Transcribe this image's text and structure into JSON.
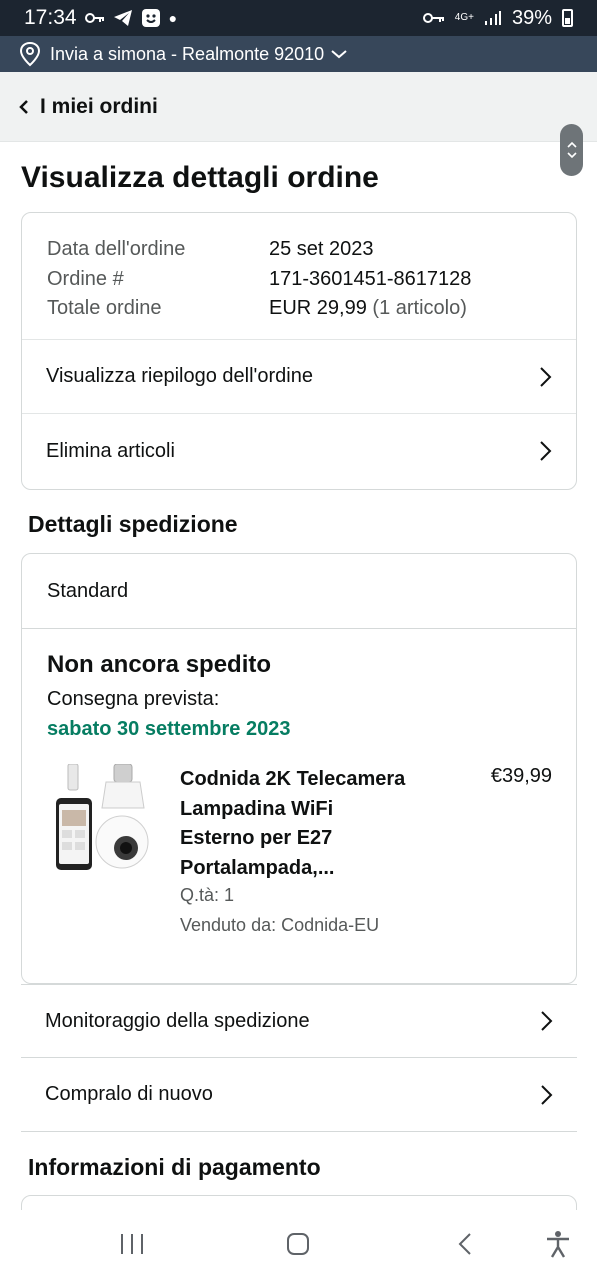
{
  "status_bar": {
    "time": "17:34",
    "network": "4G+",
    "battery": "39%"
  },
  "deliver_bar": {
    "text": "Invia a simona - Realmonte 92010"
  },
  "header": {
    "back_label": "I miei ordini"
  },
  "page": {
    "title": "Visualizza dettagli ordine"
  },
  "order_summary": {
    "rows": [
      {
        "label": "Data dell'ordine",
        "value": "25 set 2023",
        "extra": ""
      },
      {
        "label": "Ordine #",
        "value": "171-3601451-8617128",
        "extra": ""
      },
      {
        "label": "Totale ordine",
        "value": "EUR 29,99",
        "extra": "(1 articolo)"
      }
    ],
    "links": [
      "Visualizza riepilogo dell'ordine",
      "Elimina articoli"
    ]
  },
  "shipping": {
    "section_title": "Dettagli spedizione",
    "method": "Standard",
    "status": "Non ancora spedito",
    "eta_label": "Consegna prevista:",
    "eta_date": "sabato 30 settembre 2023",
    "item": {
      "title_lines": [
        "Codnida 2K Telecamera",
        "Lampadina WiFi",
        "Esterno per E27",
        "Portalampada,..."
      ],
      "price": "€39,99",
      "qty": "Q.tà: 1",
      "seller": "Venduto da: Codnida-EU"
    },
    "links": [
      "Monitoraggio della spedizione",
      "Compralo di nuovo"
    ]
  },
  "payment": {
    "section_title": "Informazioni di pagamento"
  },
  "colors": {
    "green": "#067d62",
    "header_dark": "#37475a",
    "status_bar": "#1c2530"
  }
}
